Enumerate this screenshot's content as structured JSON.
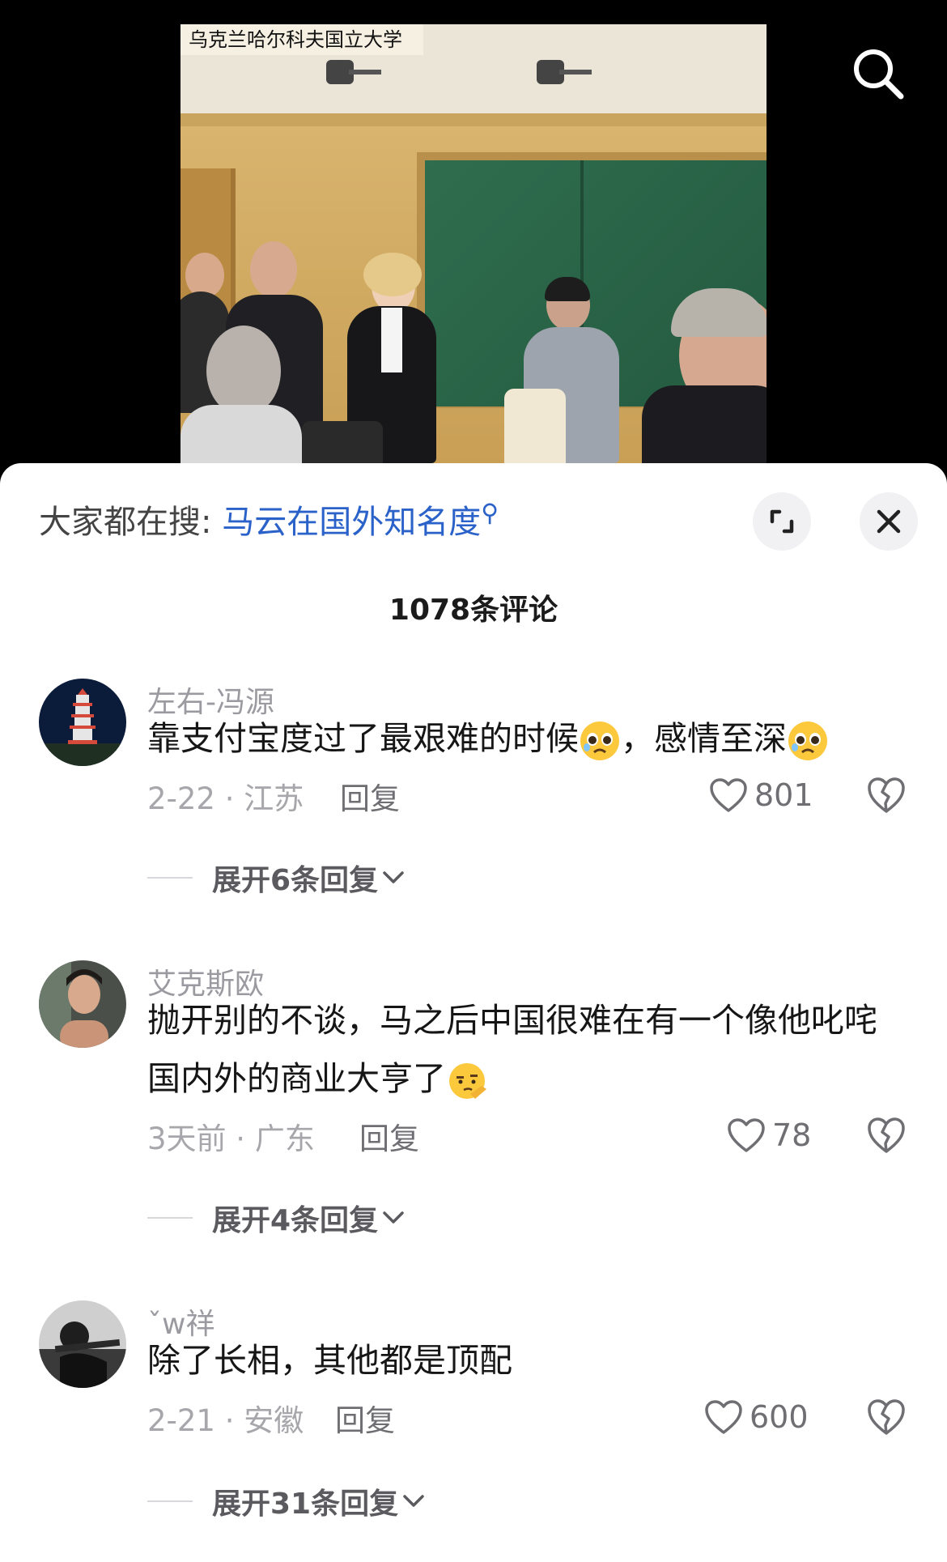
{
  "video": {
    "watermark": "乌克兰哈尔科夫国立大学"
  },
  "top": {
    "search_icon": "search-icon"
  },
  "sheet": {
    "hot_search_prefix": "大家都在搜: ",
    "hot_search_term": "马云在国外知名度",
    "expand_icon": "expand-icon",
    "close_icon": "close-icon",
    "comment_count": "1078条评论"
  },
  "comments": [
    {
      "username": "左右-冯源",
      "text_a": "靠支付宝度过了最艰难的时候",
      "text_b": "，感情至深",
      "meta": "2-22 · 江苏",
      "reply": "回复",
      "likes": "801",
      "expand": "展开6条回复"
    },
    {
      "username": "艾克斯欧",
      "text_a": "抛开别的不谈，马之后中国很难在有一个像他叱咤国内外的商业大亨了",
      "meta": "3天前 · 广东",
      "reply": "回复",
      "likes": "78",
      "expand": "展开4条回复"
    },
    {
      "username": "ˇw祥",
      "text_a": "除了长相，其他都是顶配",
      "meta": "2-21 · 安徽",
      "reply": "回复",
      "likes": "600",
      "expand": "展开31条回复"
    }
  ],
  "colors": {
    "link_blue": "#2a62c9",
    "sheet_bg": "#ffffff",
    "page_bg": "#000000"
  }
}
